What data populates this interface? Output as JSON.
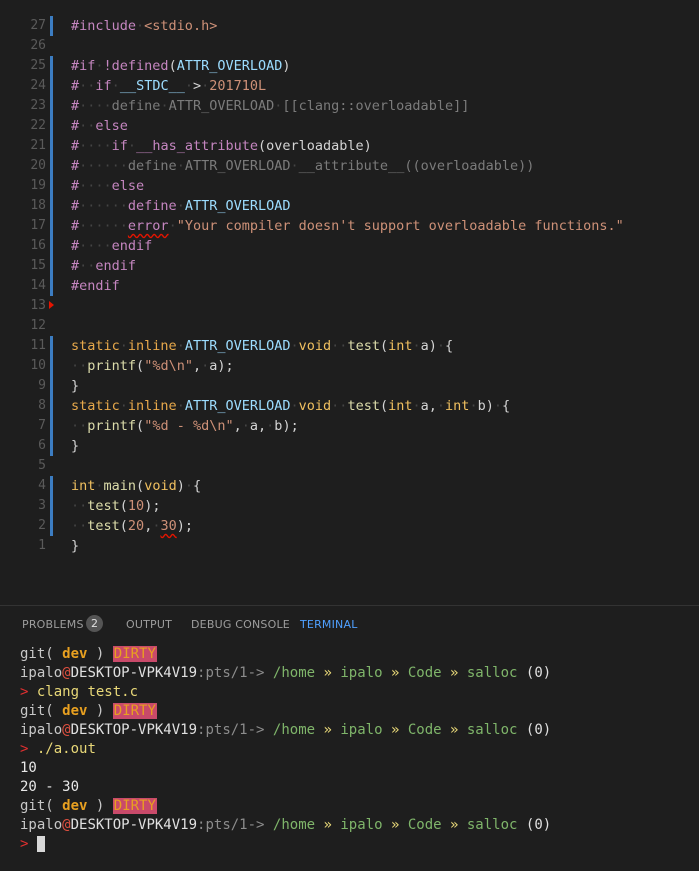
{
  "editor": {
    "lines": [
      {
        "n": "27",
        "parts": [
          [
            "pp",
            "#include"
          ],
          [
            "sp",
            "·"
          ],
          [
            "str",
            "<stdio.h>"
          ]
        ],
        "bar": true
      },
      {
        "n": "26",
        "parts": [],
        "bar": false
      },
      {
        "n": "25",
        "parts": [
          [
            "pp",
            "#if"
          ],
          [
            "sp",
            "·"
          ],
          [
            "pp",
            "!defined"
          ],
          [
            "pl",
            "("
          ],
          [
            "mac",
            "ATTR_OVERLOAD"
          ],
          [
            "pl",
            ")"
          ]
        ],
        "bar": true
      },
      {
        "n": "24",
        "parts": [
          [
            "pp",
            "#"
          ],
          [
            "sp",
            "··"
          ],
          [
            "pp",
            "if"
          ],
          [
            "sp",
            "·"
          ],
          [
            "mac",
            "__STDC__"
          ],
          [
            "sp",
            "·"
          ],
          [
            "pl",
            ">"
          ],
          [
            "sp",
            "·"
          ],
          [
            "num",
            "201710L"
          ]
        ],
        "bar": true
      },
      {
        "n": "23",
        "parts": [
          [
            "pp",
            "#"
          ],
          [
            "sp",
            "····"
          ],
          [
            "cm",
            "define"
          ],
          [
            "sp",
            "·"
          ],
          [
            "cm",
            "ATTR_OVERLOAD"
          ],
          [
            "sp",
            "·"
          ],
          [
            "cm",
            "[[clang::overloadable]]"
          ]
        ],
        "bar": true
      },
      {
        "n": "22",
        "parts": [
          [
            "pp",
            "#"
          ],
          [
            "sp",
            "··"
          ],
          [
            "pp",
            "else"
          ]
        ],
        "bar": true
      },
      {
        "n": "21",
        "parts": [
          [
            "pp",
            "#"
          ],
          [
            "sp",
            "····"
          ],
          [
            "pp",
            "if"
          ],
          [
            "sp",
            "·"
          ],
          [
            "pp",
            "__has_attribute"
          ],
          [
            "pl",
            "("
          ],
          [
            "pl",
            "overloadable"
          ],
          [
            "pl",
            ")"
          ]
        ],
        "bar": true
      },
      {
        "n": "20",
        "parts": [
          [
            "pp",
            "#"
          ],
          [
            "sp",
            "······"
          ],
          [
            "cm",
            "define"
          ],
          [
            "sp",
            "·"
          ],
          [
            "cm",
            "ATTR_OVERLOAD"
          ],
          [
            "sp",
            "·"
          ],
          [
            "cm",
            "__attribute__((overloadable))"
          ]
        ],
        "bar": true
      },
      {
        "n": "19",
        "parts": [
          [
            "pp",
            "#"
          ],
          [
            "sp",
            "····"
          ],
          [
            "pp",
            "else"
          ]
        ],
        "bar": true
      },
      {
        "n": "18",
        "parts": [
          [
            "pp",
            "#"
          ],
          [
            "sp",
            "······"
          ],
          [
            "pp",
            "define"
          ],
          [
            "sp",
            "·"
          ],
          [
            "mac",
            "ATTR_OVERLOAD"
          ]
        ],
        "bar": true
      },
      {
        "n": "17",
        "parts": [
          [
            "pp",
            "#"
          ],
          [
            "sp",
            "······"
          ],
          [
            "pp",
            "error"
          ],
          [
            "sp",
            "·"
          ],
          [
            "str",
            "\"Your compiler doesn't support overloadable functions.\""
          ]
        ],
        "bar": true,
        "squig": true
      },
      {
        "n": "16",
        "parts": [
          [
            "pp",
            "#"
          ],
          [
            "sp",
            "····"
          ],
          [
            "pp",
            "endif"
          ]
        ],
        "bar": true
      },
      {
        "n": "15",
        "parts": [
          [
            "pp",
            "#"
          ],
          [
            "sp",
            "··"
          ],
          [
            "pp",
            "endif"
          ]
        ],
        "bar": true
      },
      {
        "n": "14",
        "parts": [
          [
            "pp",
            "#endif"
          ]
        ],
        "bar": true
      },
      {
        "n": "13",
        "parts": [],
        "bar": false,
        "marker": true
      },
      {
        "n": "12",
        "parts": [],
        "bar": false
      },
      {
        "n": "11",
        "parts": [
          [
            "k",
            "static"
          ],
          [
            "sp",
            "·"
          ],
          [
            "k",
            "inline"
          ],
          [
            "sp",
            "·"
          ],
          [
            "mac",
            "ATTR_OVERLOAD"
          ],
          [
            "sp",
            "·"
          ],
          [
            "ty",
            "void"
          ],
          [
            "sp",
            "··"
          ],
          [
            "fn",
            "test"
          ],
          [
            "pl",
            "("
          ],
          [
            "ty",
            "int"
          ],
          [
            "sp",
            "·"
          ],
          [
            "id",
            "a"
          ],
          [
            "pl",
            ")"
          ],
          [
            "sp",
            "·"
          ],
          [
            "pl",
            "{"
          ]
        ],
        "bar": true
      },
      {
        "n": "10",
        "parts": [
          [
            "sp",
            "··"
          ],
          [
            "fn",
            "printf"
          ],
          [
            "pl",
            "("
          ],
          [
            "str",
            "\"%d\\n\""
          ],
          [
            "pl",
            ","
          ],
          [
            "sp",
            "·"
          ],
          [
            "id",
            "a"
          ],
          [
            "pl",
            ");"
          ]
        ],
        "bar": true
      },
      {
        "n": "9",
        "parts": [
          [
            "pl",
            "}"
          ]
        ],
        "bar": true
      },
      {
        "n": "8",
        "parts": [
          [
            "k",
            "static"
          ],
          [
            "sp",
            "·"
          ],
          [
            "k",
            "inline"
          ],
          [
            "sp",
            "·"
          ],
          [
            "mac",
            "ATTR_OVERLOAD"
          ],
          [
            "sp",
            "·"
          ],
          [
            "ty",
            "void"
          ],
          [
            "sp",
            "··"
          ],
          [
            "fn",
            "test"
          ],
          [
            "pl",
            "("
          ],
          [
            "ty",
            "int"
          ],
          [
            "sp",
            "·"
          ],
          [
            "id",
            "a"
          ],
          [
            "pl",
            ","
          ],
          [
            "sp",
            "·"
          ],
          [
            "ty",
            "int"
          ],
          [
            "sp",
            "·"
          ],
          [
            "id",
            "b"
          ],
          [
            "pl",
            ")"
          ],
          [
            "sp",
            "·"
          ],
          [
            "pl",
            "{"
          ]
        ],
        "bar": true
      },
      {
        "n": "7",
        "parts": [
          [
            "sp",
            "··"
          ],
          [
            "fn",
            "printf"
          ],
          [
            "pl",
            "("
          ],
          [
            "str",
            "\"%d - %d\\n\""
          ],
          [
            "pl",
            ","
          ],
          [
            "sp",
            "·"
          ],
          [
            "id",
            "a"
          ],
          [
            "pl",
            ","
          ],
          [
            "sp",
            "·"
          ],
          [
            "id",
            "b"
          ],
          [
            "pl",
            ");"
          ]
        ],
        "bar": true
      },
      {
        "n": "6",
        "parts": [
          [
            "pl",
            "}"
          ]
        ],
        "bar": true
      },
      {
        "n": "5",
        "parts": [],
        "bar": false
      },
      {
        "n": "4",
        "parts": [
          [
            "ty",
            "int"
          ],
          [
            "sp",
            "·"
          ],
          [
            "fn",
            "main"
          ],
          [
            "pl",
            "("
          ],
          [
            "ty",
            "void"
          ],
          [
            "pl",
            ")"
          ],
          [
            "sp",
            "·"
          ],
          [
            "pl",
            "{"
          ]
        ],
        "bar": true
      },
      {
        "n": "3",
        "parts": [
          [
            "sp",
            "··"
          ],
          [
            "fn",
            "test"
          ],
          [
            "pl",
            "("
          ],
          [
            "num",
            "10"
          ],
          [
            "pl",
            ");"
          ]
        ],
        "bar": true
      },
      {
        "n": "2",
        "parts": [
          [
            "sp",
            "··"
          ],
          [
            "fn",
            "test"
          ],
          [
            "pl",
            "("
          ],
          [
            "num",
            "20"
          ],
          [
            "pl",
            ","
          ],
          [
            "sp",
            "·"
          ],
          [
            "num",
            "30"
          ],
          [
            "pl",
            ");"
          ]
        ],
        "bar": true,
        "squig30": true
      },
      {
        "n": "1",
        "parts": [
          [
            "pl",
            "}"
          ]
        ],
        "bar": false
      }
    ]
  },
  "panel": {
    "tabs": {
      "problems": "PROBLEMS",
      "problems_count": "2",
      "output": "OUTPUT",
      "debug_console": "DEBUG CONSOLE",
      "terminal": "TERMINAL"
    }
  },
  "terminal": {
    "git_open": "git(",
    "branch": "dev",
    "git_close": ")",
    "dirty": "DIRTY",
    "user": "ipalo",
    "at": "@",
    "host": "DESKTOP-VPK4V19",
    "tty": ":pts/1->",
    "path_home": "/home",
    "path_user": "ipalo",
    "path_code": "Code",
    "path_proj": "salloc",
    "sep": "»",
    "status": "(0)",
    "prompt": ">",
    "cmd1": "clang test.c",
    "cmd2": "./a.out",
    "out1": "10",
    "out2": "20 - 30"
  }
}
